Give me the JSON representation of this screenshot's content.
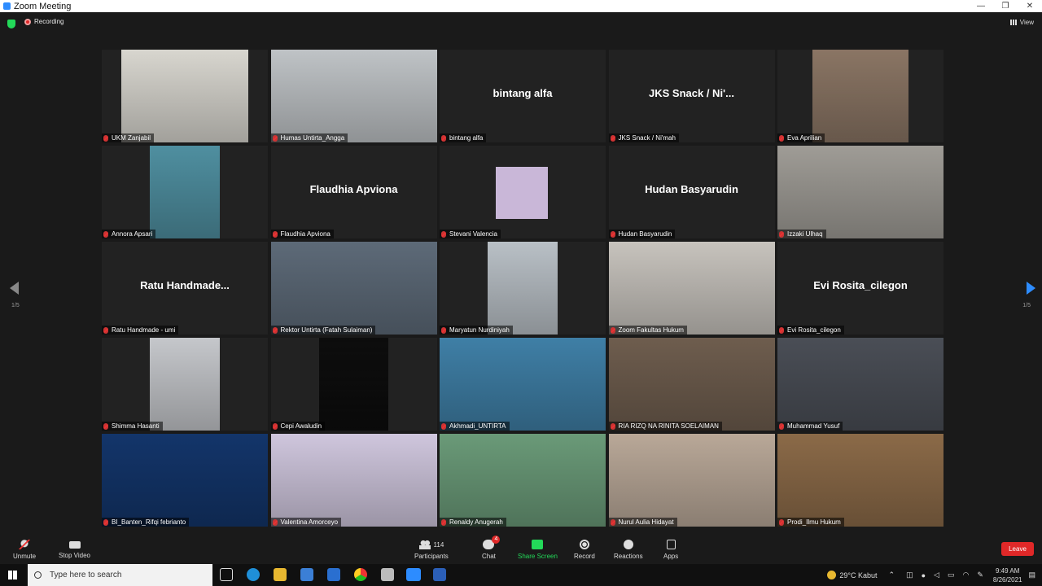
{
  "window": {
    "title": "Zoom Meeting",
    "controls": [
      "—",
      "❐",
      "✕"
    ]
  },
  "topbar": {
    "recording_label": "Recording",
    "view_label": "View"
  },
  "pagination": {
    "left": "1/5",
    "right": "1/5"
  },
  "participants": [
    {
      "name": "UKM Zanjabil",
      "type": "video",
      "vcol": "#d8d6cf",
      "vleft": 12,
      "vwidth": 76
    },
    {
      "name": "Humas Untirta_Angga",
      "type": "video",
      "vcol": "#bfc3c6",
      "vleft": 0,
      "vwidth": 100
    },
    {
      "name": "bintang alfa",
      "type": "name",
      "display": "bintang alfa"
    },
    {
      "name": "JKS Snack / Ni'mah",
      "type": "name",
      "display": "JKS Snack / Ni'..."
    },
    {
      "name": "Eva Aprilian",
      "type": "video",
      "vcol": "#8a7564",
      "vleft": 21,
      "vwidth": 58
    },
    {
      "name": "Annora Apsari",
      "type": "video",
      "vcol": "#4f8fa0",
      "vleft": 29,
      "vwidth": 42
    },
    {
      "name": "Flaudhia Apviona",
      "type": "name",
      "display": "Flaudhia Apviona"
    },
    {
      "name": "Stevani Valencia",
      "type": "image",
      "vcol": "#c9b7d8"
    },
    {
      "name": "Hudan Basyarudin",
      "type": "name",
      "display": "Hudan Basyarudin"
    },
    {
      "name": "Izzaki Ulhaq",
      "type": "video",
      "vcol": "#9f9c96",
      "vleft": 0,
      "vwidth": 100
    },
    {
      "name": "Ratu Handmade - umi",
      "type": "name",
      "display": "Ratu  Handmade..."
    },
    {
      "name": "Rektor Untirta (Fatah Sulaiman)",
      "type": "video",
      "vcol": "#5d6a78",
      "vleft": 0,
      "vwidth": 100
    },
    {
      "name": "Maryatun Nurdiniyah",
      "type": "video",
      "vcol": "#b9c0c6",
      "vleft": 29,
      "vwidth": 42
    },
    {
      "name": "Zoom Fakultas Hukum",
      "type": "video",
      "vcol": "#c7c3bd",
      "vleft": 0,
      "vwidth": 100,
      "active": true
    },
    {
      "name": "Evi Rosita_cilegon",
      "type": "name",
      "display": "Evi Rosita_cilegon"
    },
    {
      "name": "Shimma Hasanti",
      "type": "video",
      "vcol": "#c5c7cb",
      "vleft": 29,
      "vwidth": 42
    },
    {
      "name": "Cepi Awaludin",
      "type": "video",
      "vcol": "#0d0d0d",
      "vleft": 29,
      "vwidth": 42
    },
    {
      "name": "Akhmadi_UNTIRTA",
      "type": "video",
      "vcol": "#3f7fa6",
      "vleft": 0,
      "vwidth": 100
    },
    {
      "name": "RIA RIZQ NA RINITA SOELAIMAN",
      "type": "video",
      "vcol": "#6e5d4e",
      "vleft": 0,
      "vwidth": 100
    },
    {
      "name": "Muhammad Yusuf",
      "type": "video",
      "vcol": "#4a4e56",
      "vleft": 0,
      "vwidth": 100
    },
    {
      "name": "BI_Banten_Rifqi febrianto",
      "type": "video",
      "vcol": "#13356a",
      "vleft": 0,
      "vwidth": 100
    },
    {
      "name": "Valentina Amorceyo",
      "type": "video",
      "vcol": "#cfc6dd",
      "vleft": 0,
      "vwidth": 100
    },
    {
      "name": "Renaldy Anugerah",
      "type": "video",
      "vcol": "#6a9a78",
      "vleft": 0,
      "vwidth": 100
    },
    {
      "name": "Nurul Aulia Hidayat",
      "type": "video",
      "vcol": "#b9a898",
      "vleft": 0,
      "vwidth": 100
    },
    {
      "name": "Prodi_Ilmu Hukum",
      "type": "video",
      "vcol": "#8b6a48",
      "vleft": 0,
      "vwidth": 100
    }
  ],
  "toolbar": {
    "unmute": "Unmute",
    "stop_video": "Stop Video",
    "participants": "Participants",
    "participants_count": "114",
    "chat": "Chat",
    "chat_badge": "4",
    "share_screen": "Share Screen",
    "record": "Record",
    "reactions": "Reactions",
    "apps": "Apps",
    "leave": "Leave"
  },
  "taskbar": {
    "search_placeholder": "Type here to search",
    "weather": "29°C  Kabut",
    "time": "9:49 AM",
    "date": "8/26/2021"
  },
  "colors": {
    "accent": "#2d8cff",
    "active_speaker": "#c4e537",
    "leave": "#e02828",
    "share": "#23d959"
  }
}
